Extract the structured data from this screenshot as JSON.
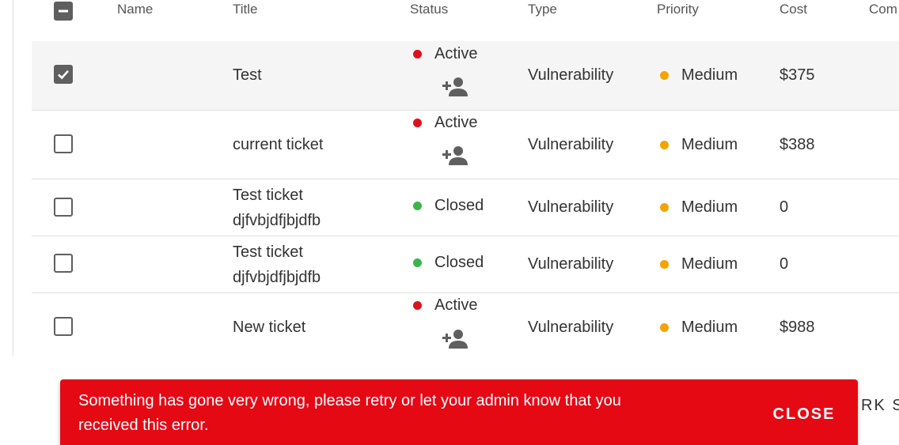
{
  "table": {
    "headers": {
      "name": "Name",
      "title": "Title",
      "status": "Status",
      "type": "Type",
      "priority": "Priority",
      "cost": "Cost",
      "comments": "Com"
    },
    "rows": [
      {
        "selected": true,
        "title_line1": "Test",
        "title_line2": "",
        "status": "Active",
        "type": "Vulnerability",
        "priority": "Medium",
        "cost": "$375"
      },
      {
        "selected": false,
        "title_line1": "current ticket",
        "title_line2": "",
        "status": "Active",
        "type": "Vulnerability",
        "priority": "Medium",
        "cost": "$388"
      },
      {
        "selected": false,
        "title_line1": "Test ticket",
        "title_line2": "djfvbjdfjbjdfb",
        "status": "Closed",
        "type": "Vulnerability",
        "priority": "Medium",
        "cost": "0"
      },
      {
        "selected": false,
        "title_line1": "Test ticket",
        "title_line2": "djfvbjdfjbjdfb",
        "status": "Closed",
        "type": "Vulnerability",
        "priority": "Medium",
        "cost": "0"
      },
      {
        "selected": false,
        "title_line1": "New ticket",
        "title_line2": "",
        "status": "Active",
        "type": "Vulnerability",
        "priority": "Medium",
        "cost": "$988"
      }
    ]
  },
  "colors": {
    "active": "#e0101a",
    "closed": "#3cb54a",
    "medium": "#f5a300",
    "snackbar": "#e50914"
  },
  "icons": {
    "assign": "person-add-icon",
    "select_all": "indeterminate-checkbox-icon",
    "checked": "check-icon"
  },
  "footer": {
    "partial_text": "RK S"
  },
  "snackbar": {
    "message": "Something has gone very wrong, please retry or let your admin know that you received this error.",
    "close_label": "CLOSE"
  }
}
